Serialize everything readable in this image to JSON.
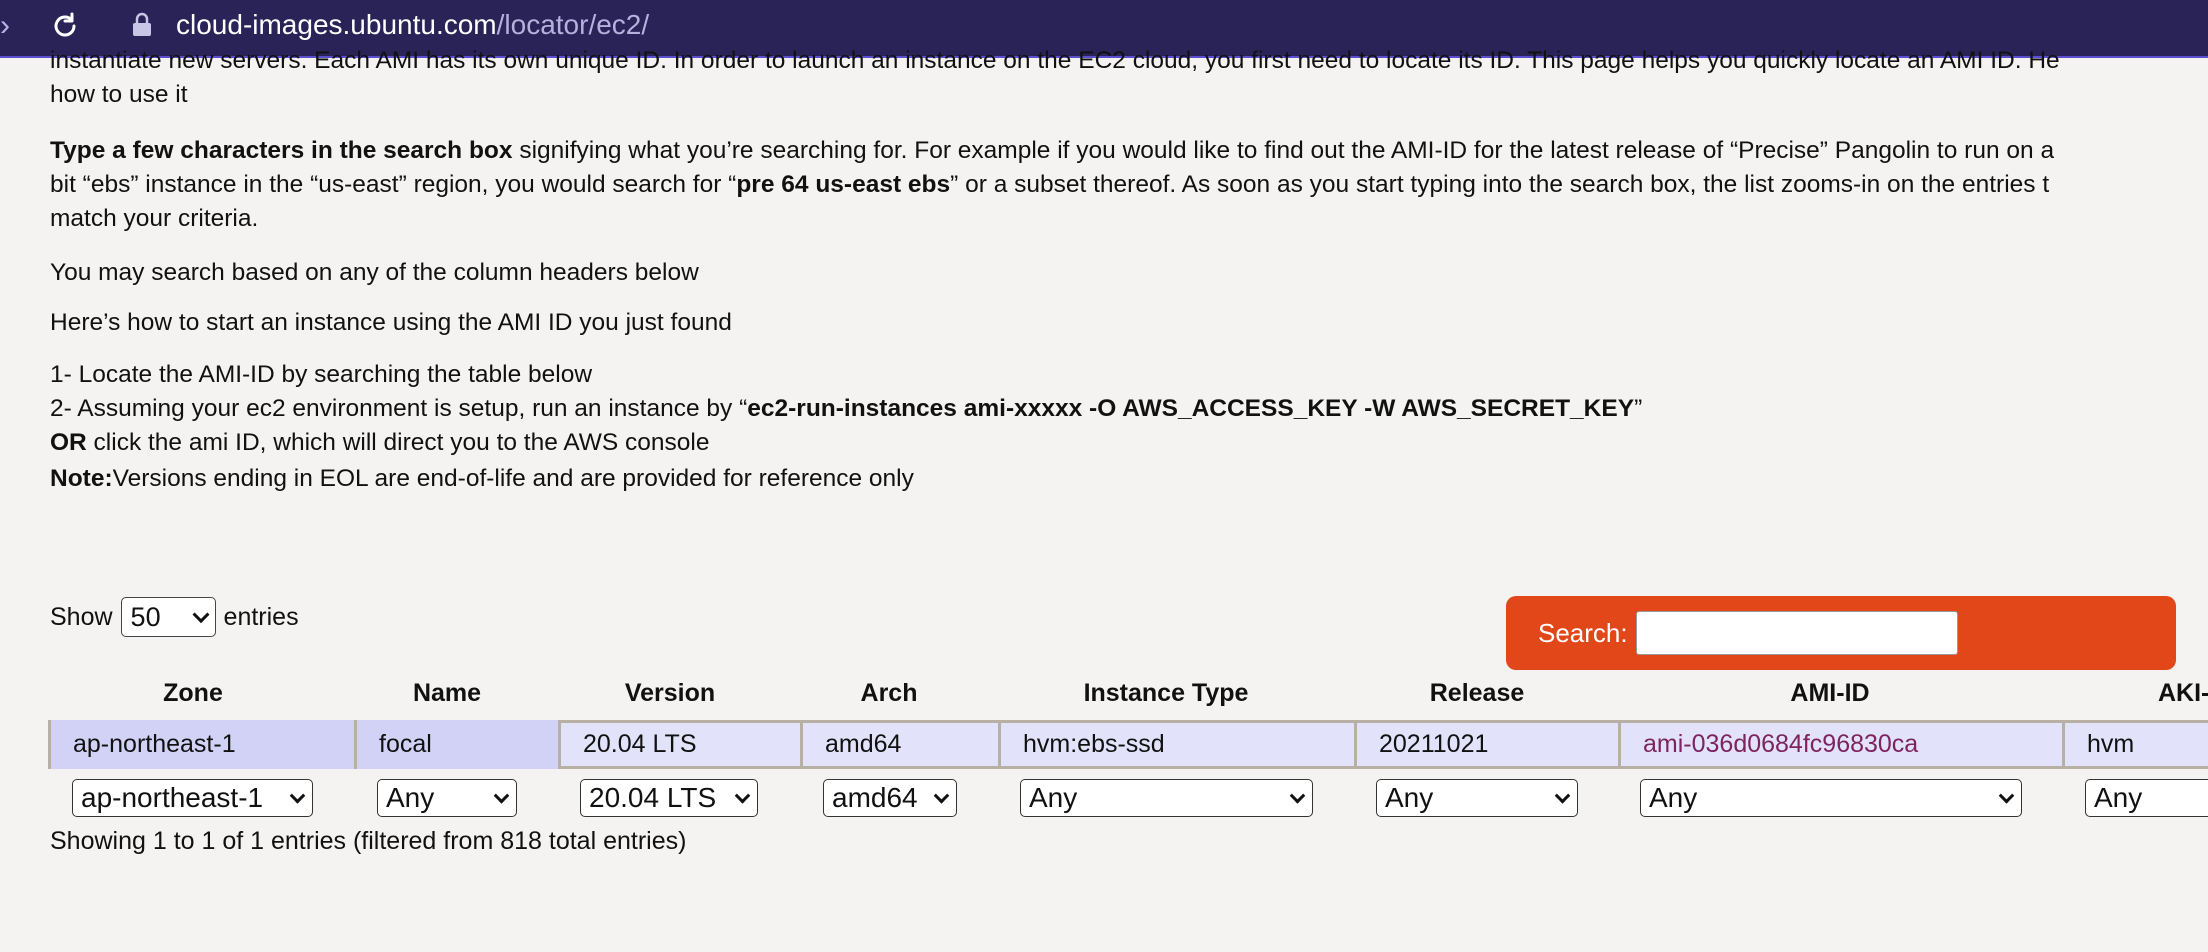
{
  "browser": {
    "url_host": "cloud-images.ubuntu.com",
    "url_path": "/locator/ec2/"
  },
  "intro": {
    "line1": "instantiate new servers. Each AMI has its own unique ID. In order to launch an instance on the EC2 cloud, you first need to locate its ID. This page helps you quickly locate an AMI ID. He",
    "line2": "how to use it",
    "search_tip_bold": "Type a few characters in the search box",
    "search_tip_1": " signifying what you’re searching for. For example if you would like to find out the AMI-ID for the latest release of “Precise” Pangolin to run on a",
    "search_tip_2a": "bit “ebs” instance in the “us-east” region, you would search for “",
    "search_tip_2b_bold": "pre 64 us-east ebs",
    "search_tip_2c": "” or a subset thereof. As soon as you start typing into the search box, the list zooms-in on the entries t",
    "search_tip_3": "match your criteria.",
    "column_hint": "You may search based on any of the column headers below",
    "howto": "Here’s how to start an instance using the AMI ID you just found",
    "step1": "1- Locate the AMI-ID by searching the table below",
    "step2a": "2- Assuming your ec2 environment is setup, run an instance by “",
    "step2b_bold": "ec2-run-instances ami-xxxxx -O AWS_ACCESS_KEY -W AWS_SECRET_KEY",
    "step2c": "”",
    "or_bold": "OR",
    "or_text": " click the ami ID, which will direct you to the AWS console",
    "note_bold": "Note:",
    "note_text": "Versions ending in EOL are end-of-life and are provided for reference only"
  },
  "length_menu": {
    "show_label": "Show",
    "value": "50",
    "entries_label": "entries"
  },
  "search": {
    "label": "Search:",
    "value": ""
  },
  "table": {
    "headers": [
      "Zone",
      "Name",
      "Version",
      "Arch",
      "Instance Type",
      "Release",
      "AMI-ID",
      "AKI-"
    ],
    "rows": [
      [
        "ap-northeast-1",
        "focal",
        "20.04 LTS",
        "amd64",
        "hvm:ebs-ssd",
        "20211021",
        "ami-036d0684fc96830ca",
        "hvm"
      ]
    ],
    "filters": [
      "ap-northeast-1",
      "Any",
      "20.04 LTS",
      "amd64",
      "Any",
      "Any",
      "Any",
      "Any"
    ],
    "info": "Showing 1 to 1 of 1 entries (filtered from 818 total entries)"
  },
  "colors": {
    "browser_bar": "#2a2358",
    "search_bg": "#e2471a",
    "row_bg": "#e2e2fa",
    "sorted_cell_bg": "#d2d2f7",
    "link": "#7d2460"
  }
}
